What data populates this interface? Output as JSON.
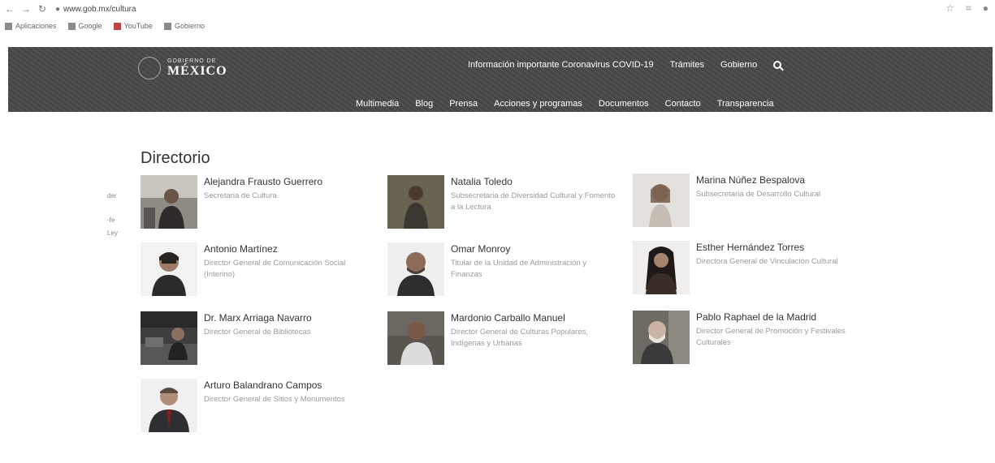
{
  "browser": {
    "url": "www.gob.mx/cultura",
    "bookmarks": [
      "Aplicaciones",
      "Google",
      "YouTube",
      "Gobierno",
      "",
      "",
      "",
      "",
      "",
      "",
      "",
      "",
      ""
    ]
  },
  "site": {
    "logo_small": "GOBIERNO DE",
    "logo_big": "MÉXICO",
    "topnav": [
      "Información importante Coronavirus COVID-19",
      "Trámites",
      "Gobierno"
    ],
    "subnav": [
      "Multimedia",
      "Blog",
      "Prensa",
      "Acciones y programas",
      "Documentos",
      "Contacto",
      "Transparencia"
    ]
  },
  "page": {
    "title": "Directorio",
    "cutoff": [
      "der",
      "-fe",
      "Ley"
    ]
  },
  "directory": [
    {
      "name": "Alejandra Frausto Guerrero",
      "role": "Secretaria de Cultura"
    },
    {
      "name": "Natalia Toledo",
      "role": "Subsecretaria de Diversidad Cultural y Fomento a la Lectura"
    },
    {
      "name": "Marina Núñez Bespalova",
      "role": "Subsecretaria de Desarrollo Cultural"
    },
    {
      "name": "Antonio Martínez",
      "role": "Director General de Comunicación Social (Interino)"
    },
    {
      "name": "Omar Monroy",
      "role": "Titular de la Unidad de Administración y Finanzas"
    },
    {
      "name": "Esther Hernández Torres",
      "role": "Directora General de Vinculación Cultural"
    },
    {
      "name": "Dr. Marx Arriaga Navarro",
      "role": "Director General de Bibliotecas"
    },
    {
      "name": "Mardonio Carballo Manuel",
      "role": "Director General de Culturas Populares, Indígenas y Urbanas"
    },
    {
      "name": "Pablo Raphael de la Madrid",
      "role": "Director General de Promoción y Festivales Culturales"
    },
    {
      "name": "Arturo Balandrano Campos",
      "role": "Director General de Sitios y Monumentos"
    }
  ],
  "colors": {
    "header_bg": "#4a4a4a",
    "name_text": "#333333",
    "role_text": "#9a9a9a"
  },
  "icons": [
    "back-icon",
    "forward-icon",
    "reload-icon",
    "search-icon",
    "star-icon",
    "profile-icon"
  ]
}
